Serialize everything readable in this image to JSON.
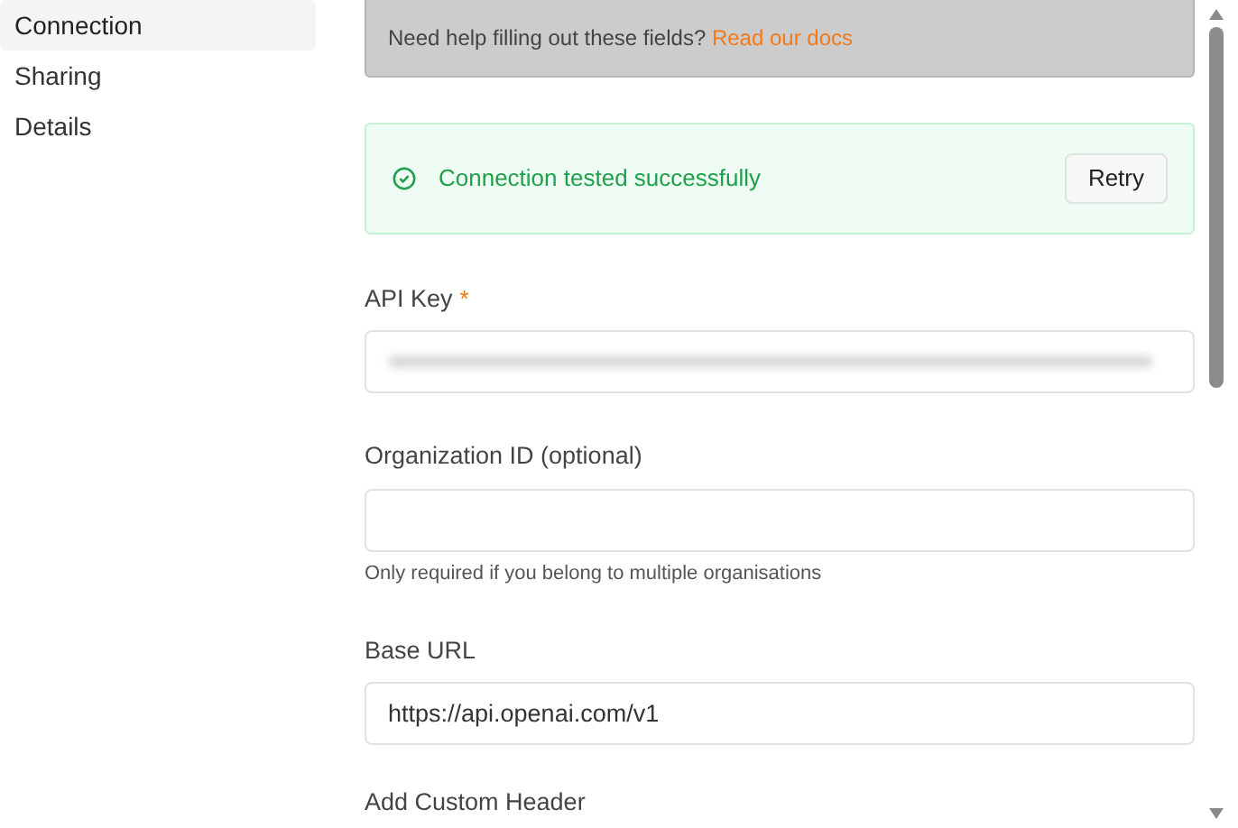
{
  "sidebar": {
    "items": [
      {
        "label": "Connection",
        "selected": true
      },
      {
        "label": "Sharing",
        "selected": false
      },
      {
        "label": "Details",
        "selected": false
      }
    ]
  },
  "help": {
    "text": "Need help filling out these fields?",
    "link": "Read our docs"
  },
  "status": {
    "message": "Connection tested successfully",
    "button": "Retry"
  },
  "fields": [
    {
      "label": "API Key",
      "required_mark": "*",
      "masked": true
    },
    {
      "label": "Organization ID (optional)",
      "masked": false,
      "hint": "Only required if you belong to multiple organisations"
    },
    {
      "label": "Base URL",
      "masked": false,
      "value": "https://api.openai.com/v1"
    }
  ],
  "next_section": "Add Custom Header"
}
